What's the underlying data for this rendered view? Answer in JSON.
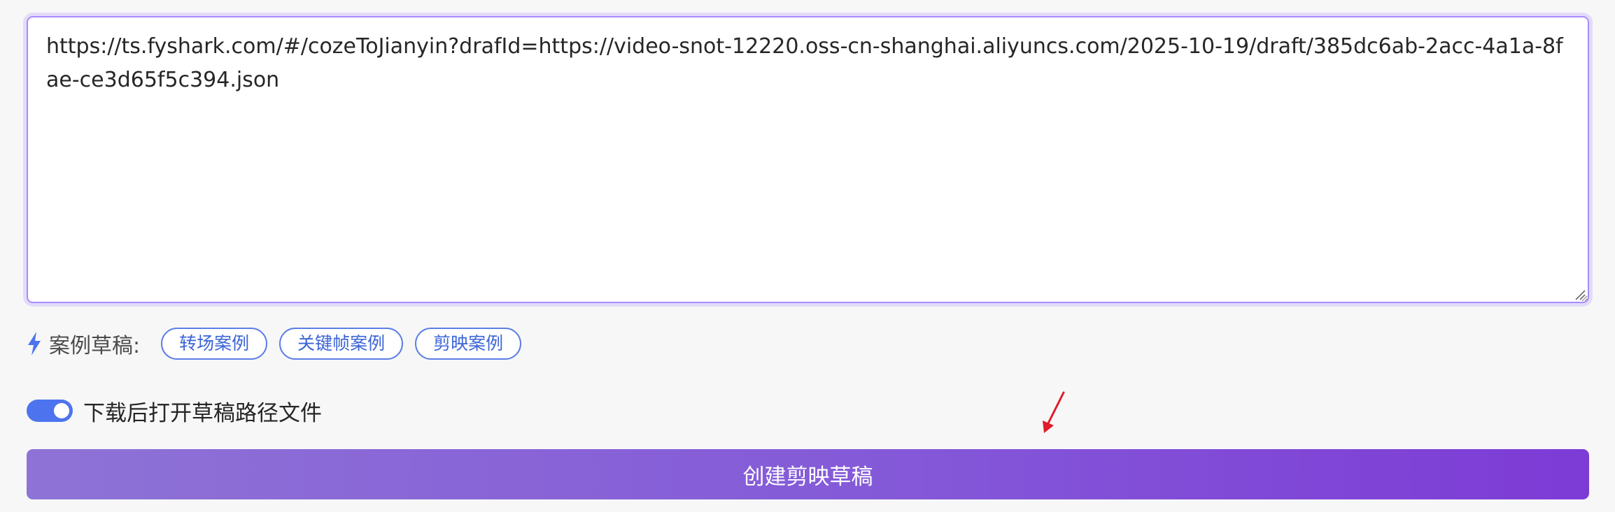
{
  "editor": {
    "url_value": "https://ts.fyshark.com/#/cozeToJianyin?drafId=https://video-snot-12220.oss-cn-shanghai.aliyuncs.com/2025-10-19/draft/385dc6ab-2acc-4a1a-8fae-ce3d65f5c394.json",
    "placeholder": ""
  },
  "examples": {
    "label": "案例草稿:",
    "icon": "lightning-bolt-icon",
    "items": [
      {
        "label": "转场案例"
      },
      {
        "label": "关键帧案例"
      },
      {
        "label": "剪映案例"
      }
    ]
  },
  "toggle": {
    "label": "下载后打开草稿路径文件",
    "checked": true
  },
  "action": {
    "create_label": "创建剪映草稿"
  },
  "colors": {
    "accent": "#4d74ee",
    "chip_border": "#5b7ee5",
    "textarea_border": "#a78bfa",
    "button_gradient_start": "#8e73d6",
    "button_gradient_end": "#7d3bd6",
    "annotation_arrow": "#e01b2a"
  }
}
